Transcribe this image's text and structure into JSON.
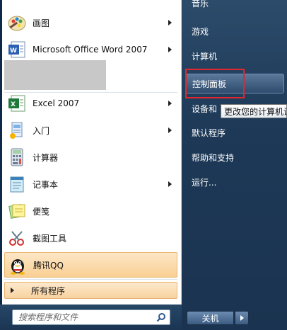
{
  "left_items": [
    {
      "label": "画图",
      "icon": "paint-icon",
      "submenu": true
    },
    {
      "label": "Microsoft Office Word 2007",
      "icon": "word-icon",
      "submenu": true
    },
    {
      "label": "Excel 2007",
      "icon": "excel-icon",
      "submenu": true
    },
    {
      "label": "入门",
      "icon": "getting-started-icon",
      "submenu": true
    },
    {
      "label": "计算器",
      "icon": "calculator-icon",
      "submenu": false
    },
    {
      "label": "记事本",
      "icon": "notepad-icon",
      "submenu": true
    },
    {
      "label": "便笺",
      "icon": "sticky-notes-icon",
      "submenu": false
    },
    {
      "label": "截图工具",
      "icon": "snipping-tool-icon",
      "submenu": false
    },
    {
      "label": "腾讯QQ",
      "icon": "qq-icon",
      "submenu": false
    }
  ],
  "all_programs": "所有程序",
  "search": {
    "placeholder": "搜索程序和文件",
    "icon": "search-icon"
  },
  "right_items": [
    {
      "label": "音乐"
    },
    {
      "label": "游戏"
    },
    {
      "label": "计算机"
    },
    {
      "label": "控制面板"
    },
    {
      "label": "设备和"
    },
    {
      "label": "默认程序"
    },
    {
      "label": "帮助和支持"
    },
    {
      "label": "运行..."
    }
  ],
  "tooltip": "更改您的计算机设",
  "shutdown": {
    "label": "关机"
  },
  "colors": {
    "highlight": "#f9cf93",
    "panel": "#1d3957",
    "annotation": "#e1262d"
  }
}
